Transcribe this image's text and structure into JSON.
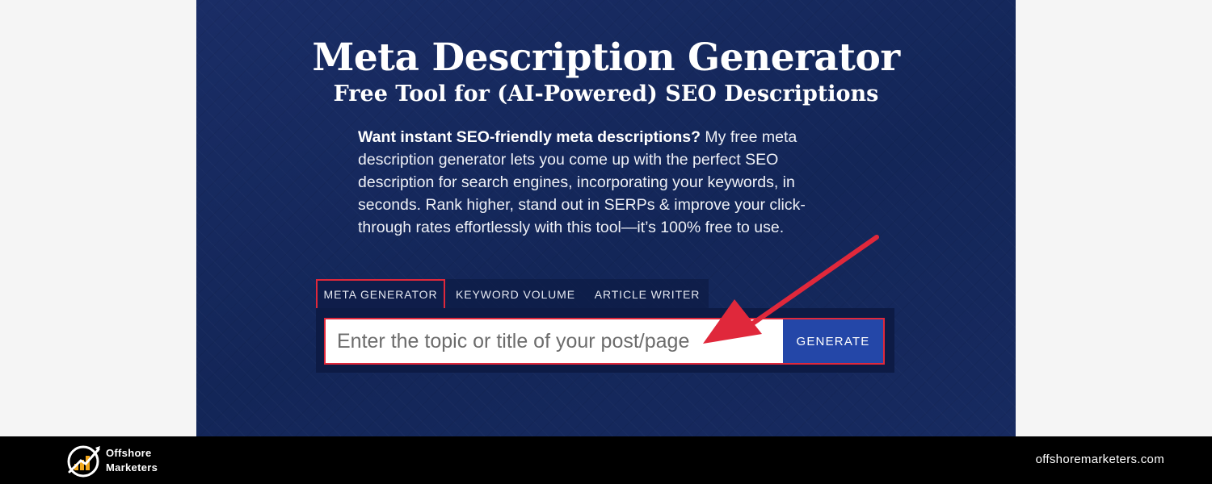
{
  "hero": {
    "title": "Meta Description Generator",
    "subtitle": "Free Tool for (AI-Powered) SEO Descriptions",
    "intro_bold": "Want instant SEO-friendly meta descriptions?",
    "intro_text": " My free meta description generator lets you come up with the perfect SEO description for search engines, incorporating your keywords, in seconds. Rank higher, stand out in SERPs & improve your click-through rates effortlessly with this tool—it’s 100% free to use."
  },
  "tabs": [
    {
      "label": "META GENERATOR",
      "active": true
    },
    {
      "label": "KEYWORD VOLUME",
      "active": false
    },
    {
      "label": "ARTICLE WRITER",
      "active": false
    }
  ],
  "form": {
    "placeholder": "Enter the topic or title of your post/page",
    "value": "",
    "button_label": "GENERATE"
  },
  "annotation": {
    "icon": "red-arrow-icon",
    "color": "#e0283b"
  },
  "footer": {
    "brand_line1": "Offshore",
    "brand_line2": "Marketers",
    "website": "offshoremarketers.com",
    "logo_icon": "growth-chart-logo-icon"
  },
  "colors": {
    "hero_bg": "#15285e",
    "highlight": "#e0283b",
    "button": "#2447a8",
    "footer_bg": "#000000"
  }
}
